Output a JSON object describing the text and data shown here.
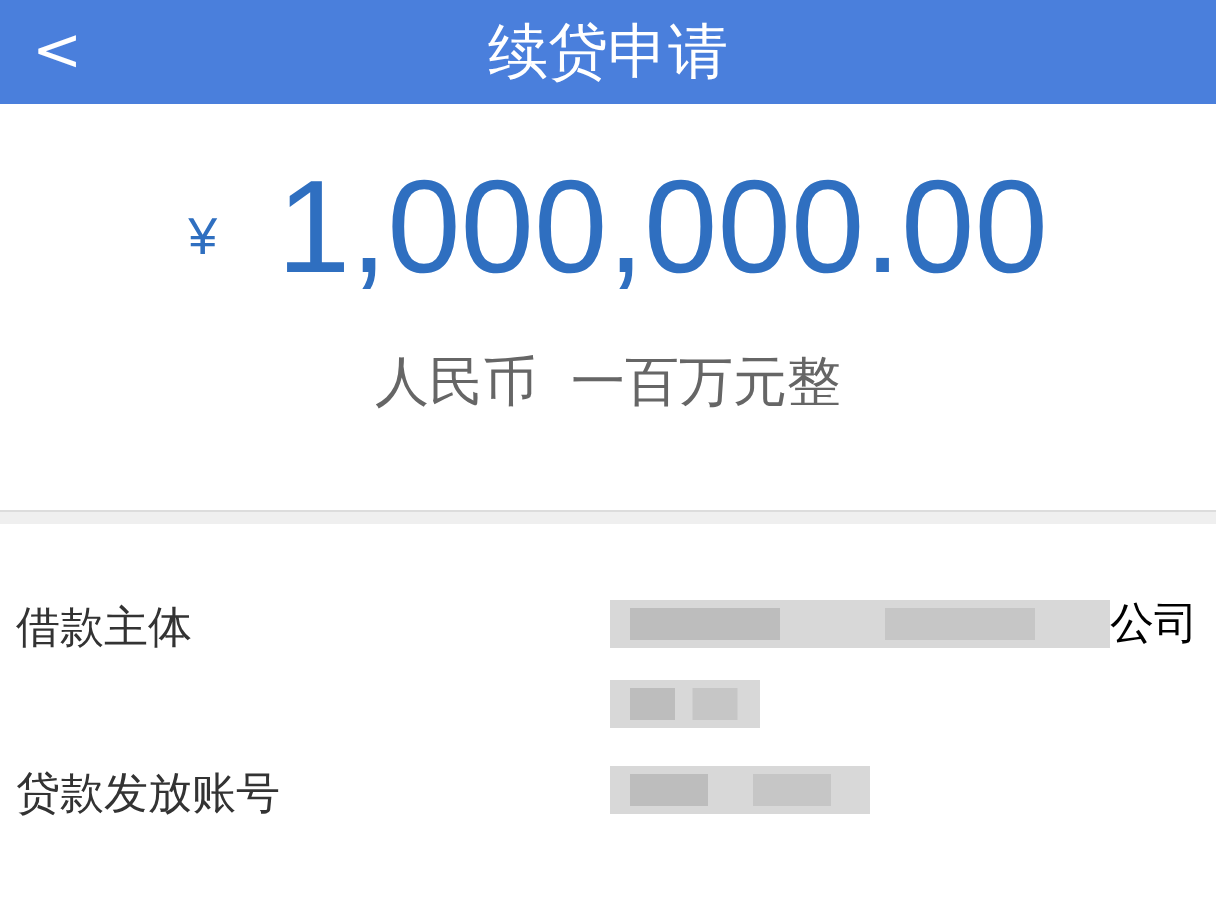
{
  "header": {
    "back": "<",
    "title": "续贷申请"
  },
  "amount": {
    "currency_symbol": "¥",
    "value": "1,000,000.00",
    "in_words": "人民币  一百万元整"
  },
  "fields": [
    {
      "label": "借款主体",
      "value_visible": "公司",
      "kind": "two_line"
    },
    {
      "label": "贷款发放账号",
      "kind": "one_line"
    }
  ]
}
